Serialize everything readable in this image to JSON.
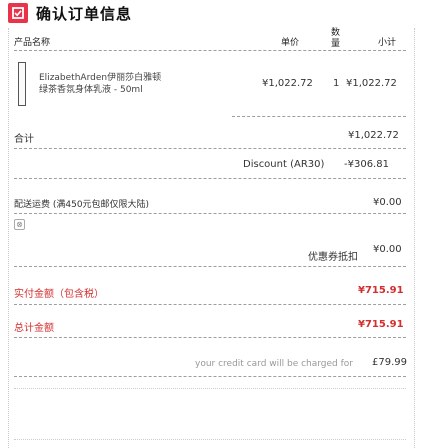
{
  "header": {
    "title": "确认订单信息"
  },
  "table_header": {
    "product": "产品名称",
    "unit_price": "单价",
    "quantity": "数量",
    "subtotal": "小计"
  },
  "item": {
    "name_line1": "ElizabethArden伊丽莎白雅顿",
    "name_line2": "绿茶香氛身体乳液 - 50ml",
    "unit_price": "¥1,022.72",
    "quantity": "1",
    "subtotal": "¥1,022.72"
  },
  "summary": {
    "total_label": "合计",
    "total_value": "¥1,022.72",
    "discount_label": "Discount (AR30)",
    "discount_value": "-¥306.81",
    "shipping_label": "配送运费 (满450元包邮仅限大陆)",
    "shipping_value": "¥0.00",
    "coupon_label": "优惠券抵扣",
    "coupon_value": "¥0.00",
    "pay_label": "实付金额（包含税）",
    "pay_value": "¥715.91",
    "grand_label": "总计金额",
    "grand_value": "¥715.91",
    "charge_label": "your credit card will be charged for",
    "charge_value": "£79.99"
  }
}
